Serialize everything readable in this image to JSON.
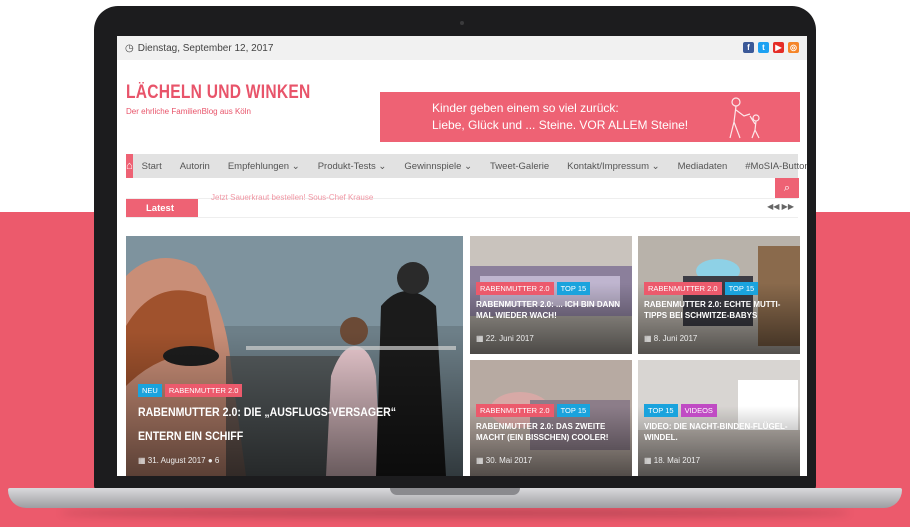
{
  "topbar": {
    "date": "Dienstag, September 12, 2017",
    "clock_icon": "clock-icon",
    "social": [
      {
        "icon": "facebook-icon",
        "glyph": "f",
        "color": "#3b5998"
      },
      {
        "icon": "twitter-icon",
        "glyph": "t",
        "color": "#1da1f2"
      },
      {
        "icon": "youtube-icon",
        "glyph": "▶",
        "color": "#e52d27"
      },
      {
        "icon": "instagram-icon",
        "glyph": "◎",
        "color": "#f58529"
      }
    ]
  },
  "header": {
    "site_title": "LÄCHELN UND WINKEN",
    "tagline": "Der ehrliche FamilienBlog aus Köln",
    "banner_line1": "Kinder geben einem so viel zurück:",
    "banner_line2": "Liebe, Glück und ... Steine. VOR ALLEM Steine!"
  },
  "nav": {
    "home_icon": "⌂",
    "items": [
      "Start",
      "Autorin",
      "Empfehlungen ⌄",
      "Produkt-Tests ⌄",
      "Gewinnspiele ⌄",
      "Tweet-Galerie",
      "Kontakt/Impressum ⌄",
      "Mediadaten",
      "#MoSIA-Button"
    ],
    "search_glyph": "⌕"
  },
  "latest": {
    "label": "Latest",
    "ticker": "Jetzt Sauerkraut bestellen! Sous-Chef Krause",
    "arrows": "◀◀ ▶▶"
  },
  "posts": {
    "featured": {
      "tags": [
        "NEU",
        "RABENMUTTER 2.0"
      ],
      "title": "RABENMUTTER 2.0: DIE „AUSFLUGS-VERSAGER“ ENTERN EIN SCHIFF",
      "date": "31. August 2017",
      "comments": "6"
    },
    "p1": {
      "tags": [
        "RABENMUTTER 2.0",
        "TOP 15"
      ],
      "title": "RABENMUTTER 2.0: ... ICH BIN DANN MAL WIEDER WACH!",
      "date": "22. Juni 2017"
    },
    "p2": {
      "tags": [
        "RABENMUTTER 2.0",
        "TOP 15"
      ],
      "title": "RABENMUTTER 2.0: ECHTE MUTTI-TIPPS BEI SCHWITZE-BABYS",
      "date": "8. Juni 2017"
    },
    "p3": {
      "tags": [
        "RABENMUTTER 2.0",
        "TOP 15"
      ],
      "title": "RABENMUTTER 2.0: DAS ZWEITE MACHT (EIN BISSCHEN) COOLER!",
      "date": "30. Mai 2017"
    },
    "p4": {
      "tags": [
        "TOP 15",
        "VIDEOS"
      ],
      "title": "VIDEO: DIE NACHT-BINDEN-FLÜGEL-WINDEL.",
      "date": "18. Mai 2017"
    }
  },
  "colors": {
    "accent": "#ec5a6c",
    "blue_tag": "#1aa3dd",
    "purple_tag": "#c04bc4"
  }
}
